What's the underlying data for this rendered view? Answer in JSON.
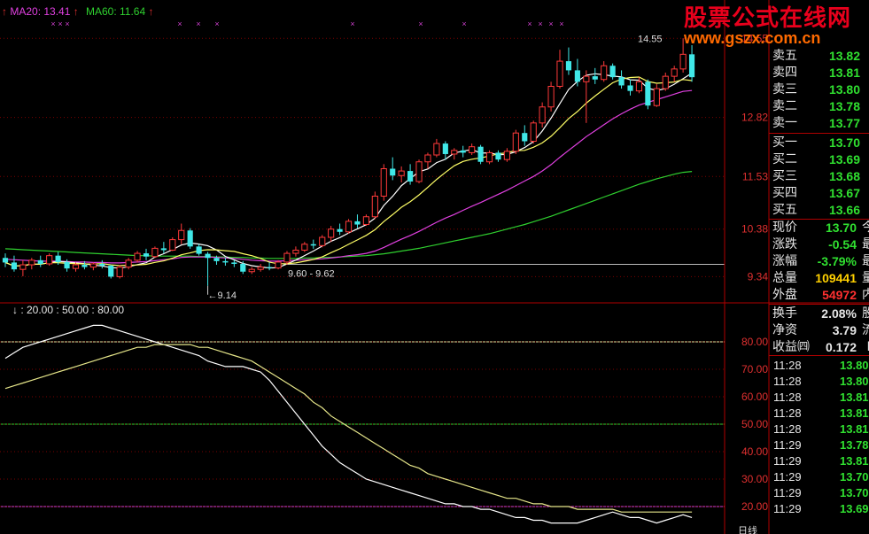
{
  "ma_labels": {
    "ma20": "MA20: 13.41",
    "ma60": "MA60: 11.64",
    "ma20_color": "#e040e0",
    "ma60_color": "#2fd02f"
  },
  "price_axis": {
    "ticks": [
      "14.55",
      "12.82",
      "11.53",
      "10.38",
      "9.34"
    ],
    "color": "#e03030"
  },
  "price_annotations": {
    "low_label": "9.14",
    "range_label": "9.60 - 9.62",
    "high_label": "14.55"
  },
  "indicator": {
    "label": "↓ : 20.00 : 50.00 : 80.00",
    "ticks": [
      "80.00",
      "70.00",
      "60.00",
      "50.00",
      "40.00",
      "30.00",
      "20.00"
    ]
  },
  "watermark": {
    "title": "股票公式在线网",
    "url": "www.gszx.com.cn"
  },
  "order_book": [
    {
      "label": "卖五",
      "value": "13.82",
      "color": "#30e030"
    },
    {
      "label": "卖四",
      "value": "13.81",
      "color": "#30e030"
    },
    {
      "label": "卖三",
      "value": "13.80",
      "color": "#30e030"
    },
    {
      "label": "卖二",
      "value": "13.78",
      "color": "#30e030"
    },
    {
      "label": "卖一",
      "value": "13.77",
      "color": "#30e030"
    },
    {
      "label": "买一",
      "value": "13.70",
      "color": "#30e030"
    },
    {
      "label": "买二",
      "value": "13.69",
      "color": "#30e030"
    },
    {
      "label": "买三",
      "value": "13.68",
      "color": "#30e030"
    },
    {
      "label": "买四",
      "value": "13.67",
      "color": "#30e030"
    },
    {
      "label": "买五",
      "value": "13.66",
      "color": "#30e030"
    }
  ],
  "quote_info": [
    {
      "label": "现价",
      "value": "13.70",
      "color": "#30e030",
      "extra": "今"
    },
    {
      "label": "涨跌",
      "value": "-0.54",
      "color": "#30e030",
      "extra": "最"
    },
    {
      "label": "涨幅",
      "value": "-3.79%",
      "color": "#30e030",
      "extra": "最"
    },
    {
      "label": "总量",
      "value": "109441",
      "color": "#ffd000",
      "extra": "量"
    },
    {
      "label": "外盘",
      "value": "54972",
      "color": "#ff3030",
      "extra": "内"
    }
  ],
  "stats": [
    {
      "label": "换手",
      "value": "2.08%",
      "color": "#e6e6e6",
      "extra": "股"
    },
    {
      "label": "净资",
      "value": "3.79",
      "color": "#e6e6e6",
      "extra": "流"
    },
    {
      "label": "收益㈣",
      "value": "0.172",
      "color": "#e6e6e6",
      "extra": "P"
    }
  ],
  "ticks": [
    {
      "time": "11:28",
      "price": "13.80",
      "color": "#30e030"
    },
    {
      "time": "11:28",
      "price": "13.80",
      "color": "#30e030"
    },
    {
      "time": "11:28",
      "price": "13.81",
      "color": "#30e030"
    },
    {
      "time": "11:28",
      "price": "13.81",
      "color": "#30e030"
    },
    {
      "time": "11:28",
      "price": "13.81",
      "color": "#30e030"
    },
    {
      "time": "11:29",
      "price": "13.78",
      "color": "#30e030"
    },
    {
      "time": "11:29",
      "price": "13.81",
      "color": "#30e030"
    },
    {
      "time": "11:29",
      "price": "13.70",
      "color": "#30e030"
    },
    {
      "time": "11:29",
      "price": "13.70",
      "color": "#30e030"
    },
    {
      "time": "11:29",
      "price": "13.69",
      "color": "#30e030"
    }
  ],
  "bottom_label": "日线",
  "chart_data": {
    "type": "candlestick",
    "candles": [
      [
        9.75,
        9.85,
        9.55,
        9.65
      ],
      [
        9.65,
        9.8,
        9.45,
        9.5
      ],
      [
        9.5,
        9.7,
        9.35,
        9.6
      ],
      [
        9.6,
        9.75,
        9.5,
        9.7
      ],
      [
        9.7,
        9.8,
        9.55,
        9.62
      ],
      [
        9.62,
        9.85,
        9.58,
        9.8
      ],
      [
        9.8,
        9.88,
        9.6,
        9.66
      ],
      [
        9.66,
        9.72,
        9.45,
        9.52
      ],
      [
        9.52,
        9.65,
        9.45,
        9.6
      ],
      [
        9.6,
        9.68,
        9.5,
        9.55
      ],
      [
        9.55,
        9.65,
        9.48,
        9.62
      ],
      [
        9.62,
        9.7,
        9.52,
        9.58
      ],
      [
        9.58,
        9.6,
        9.3,
        9.34
      ],
      [
        9.34,
        9.6,
        9.3,
        9.55
      ],
      [
        9.55,
        9.75,
        9.5,
        9.7
      ],
      [
        9.7,
        9.9,
        9.65,
        9.85
      ],
      [
        9.85,
        9.95,
        9.7,
        9.78
      ],
      [
        9.78,
        10.0,
        9.75,
        9.96
      ],
      [
        9.96,
        10.1,
        9.85,
        9.92
      ],
      [
        9.92,
        10.2,
        9.9,
        10.15
      ],
      [
        10.15,
        10.5,
        10.05,
        10.35
      ],
      [
        10.35,
        10.4,
        9.95,
        10.0
      ],
      [
        10.0,
        10.05,
        9.8,
        9.84
      ],
      [
        9.84,
        9.88,
        9.14,
        9.75
      ],
      [
        9.75,
        9.8,
        9.6,
        9.68
      ],
      [
        9.68,
        9.75,
        9.58,
        9.65
      ],
      [
        9.65,
        9.7,
        9.55,
        9.62
      ],
      [
        9.62,
        9.68,
        9.4,
        9.45
      ],
      [
        9.45,
        9.55,
        9.4,
        9.5
      ],
      [
        9.5,
        9.62,
        9.45,
        9.55
      ],
      [
        9.55,
        9.65,
        9.48,
        9.53
      ],
      [
        9.53,
        9.7,
        9.5,
        9.66
      ],
      [
        9.66,
        9.9,
        9.6,
        9.85
      ],
      [
        9.85,
        10.0,
        9.78,
        9.92
      ],
      [
        9.92,
        10.1,
        9.88,
        10.05
      ],
      [
        10.05,
        10.15,
        9.95,
        10.02
      ],
      [
        10.02,
        10.25,
        9.98,
        10.2
      ],
      [
        10.2,
        10.45,
        10.1,
        10.38
      ],
      [
        10.38,
        10.5,
        10.25,
        10.32
      ],
      [
        10.32,
        10.6,
        10.28,
        10.55
      ],
      [
        10.55,
        10.7,
        10.4,
        10.48
      ],
      [
        10.48,
        10.7,
        10.45,
        10.65
      ],
      [
        10.65,
        11.2,
        10.6,
        11.1
      ],
      [
        11.1,
        11.8,
        11.0,
        11.7
      ],
      [
        11.7,
        11.95,
        11.45,
        11.55
      ],
      [
        11.55,
        11.75,
        11.4,
        11.65
      ],
      [
        11.65,
        11.8,
        11.35,
        11.42
      ],
      [
        11.42,
        11.9,
        11.38,
        11.85
      ],
      [
        11.85,
        12.05,
        11.7,
        12.0
      ],
      [
        12.0,
        12.35,
        11.95,
        12.25
      ],
      [
        12.25,
        12.3,
        11.9,
        12.02
      ],
      [
        12.02,
        12.15,
        11.9,
        12.1
      ],
      [
        12.1,
        12.2,
        11.95,
        12.05
      ],
      [
        12.05,
        12.25,
        12.0,
        12.18
      ],
      [
        12.18,
        12.22,
        11.8,
        11.85
      ],
      [
        11.85,
        12.1,
        11.8,
        12.05
      ],
      [
        12.05,
        12.1,
        11.85,
        11.9
      ],
      [
        11.9,
        12.15,
        11.85,
        12.08
      ],
      [
        12.08,
        12.55,
        12.02,
        12.48
      ],
      [
        12.48,
        12.65,
        12.2,
        12.3
      ],
      [
        12.3,
        12.75,
        12.25,
        12.7
      ],
      [
        12.7,
        13.15,
        12.6,
        13.05
      ],
      [
        13.05,
        13.6,
        12.95,
        13.5
      ],
      [
        13.5,
        14.3,
        13.45,
        14.05
      ],
      [
        14.05,
        14.35,
        13.75,
        13.85
      ],
      [
        13.85,
        14.1,
        13.5,
        13.6
      ],
      [
        13.6,
        13.85,
        12.7,
        13.72
      ],
      [
        13.72,
        13.9,
        13.55,
        13.65
      ],
      [
        13.65,
        14.05,
        13.6,
        13.95
      ],
      [
        13.95,
        14.0,
        13.65,
        13.7
      ],
      [
        13.7,
        13.85,
        13.45,
        13.52
      ],
      [
        13.52,
        13.65,
        13.3,
        13.4
      ],
      [
        13.4,
        13.7,
        13.35,
        13.6
      ],
      [
        13.6,
        13.65,
        13.0,
        13.08
      ],
      [
        13.08,
        13.55,
        13.05,
        13.45
      ],
      [
        13.45,
        13.8,
        13.4,
        13.72
      ],
      [
        13.72,
        13.95,
        13.6,
        13.88
      ],
      [
        13.88,
        14.55,
        13.8,
        14.2
      ],
      [
        14.2,
        14.4,
        13.6,
        13.7
      ]
    ],
    "ma20": [
      9.72,
      9.71,
      9.7,
      9.69,
      9.68,
      9.68,
      9.68,
      9.67,
      9.66,
      9.66,
      9.65,
      9.65,
      9.64,
      9.64,
      9.65,
      9.66,
      9.67,
      9.69,
      9.71,
      9.73,
      9.76,
      9.77,
      9.77,
      9.77,
      9.76,
      9.75,
      9.74,
      9.72,
      9.7,
      9.69,
      9.68,
      9.68,
      9.69,
      9.7,
      9.71,
      9.72,
      9.73,
      9.75,
      9.77,
      9.8,
      9.82,
      9.85,
      9.9,
      9.98,
      10.07,
      10.16,
      10.24,
      10.33,
      10.43,
      10.53,
      10.62,
      10.7,
      10.79,
      10.88,
      10.96,
      11.05,
      11.14,
      11.23,
      11.33,
      11.43,
      11.53,
      11.65,
      11.79,
      11.95,
      12.1,
      12.25,
      12.4,
      12.53,
      12.66,
      12.79,
      12.9,
      13.0,
      13.09,
      13.15,
      13.21,
      13.27,
      13.33,
      13.39,
      13.41
    ],
    "ma60": [
      9.95,
      9.94,
      9.93,
      9.92,
      9.91,
      9.9,
      9.89,
      9.88,
      9.87,
      9.86,
      9.85,
      9.84,
      9.83,
      9.82,
      9.81,
      9.8,
      9.8,
      9.79,
      9.79,
      9.79,
      9.79,
      9.79,
      9.78,
      9.78,
      9.77,
      9.77,
      9.76,
      9.76,
      9.75,
      9.75,
      9.74,
      9.74,
      9.74,
      9.74,
      9.75,
      9.75,
      9.76,
      9.76,
      9.77,
      9.78,
      9.79,
      9.8,
      9.82,
      9.84,
      9.87,
      9.9,
      9.93,
      9.96,
      10.0,
      10.04,
      10.08,
      10.12,
      10.16,
      10.2,
      10.24,
      10.28,
      10.33,
      10.38,
      10.43,
      10.48,
      10.54,
      10.6,
      10.66,
      10.73,
      10.8,
      10.87,
      10.94,
      11.01,
      11.08,
      11.15,
      11.22,
      11.29,
      11.36,
      11.42,
      11.48,
      11.53,
      11.58,
      11.62,
      11.64
    ],
    "ylim": [
      9.0,
      15.0
    ],
    "indicator_series": [
      {
        "values": [
          74,
          76,
          78,
          79,
          80,
          81,
          82,
          83,
          84,
          85,
          86,
          86,
          85,
          84,
          83,
          82,
          81,
          80,
          79,
          78,
          77,
          76,
          75,
          73,
          72,
          71,
          71,
          71,
          70,
          69,
          66,
          62,
          58,
          54,
          50,
          46,
          42,
          39,
          36,
          34,
          32,
          30,
          29,
          28,
          27,
          26,
          25,
          24,
          23,
          22,
          21,
          21,
          20,
          20,
          19,
          19,
          18,
          17,
          16,
          16,
          15,
          15,
          14,
          14,
          14,
          14,
          15,
          16,
          17,
          18,
          17,
          16,
          16,
          15,
          14,
          15,
          16,
          17,
          16
        ]
      },
      {
        "values": [
          63,
          64,
          65,
          66,
          67,
          68,
          69,
          70,
          71,
          72,
          73,
          74,
          75,
          76,
          77,
          78,
          78,
          79,
          79,
          79,
          79,
          79,
          78,
          78,
          77,
          76,
          75,
          74,
          73,
          71,
          69,
          67,
          65,
          63,
          61,
          58,
          56,
          53,
          51,
          49,
          47,
          45,
          43,
          41,
          39,
          37,
          35,
          34,
          32,
          31,
          30,
          29,
          28,
          27,
          26,
          25,
          24,
          23,
          23,
          22,
          21,
          21,
          20,
          20,
          20,
          19,
          19,
          19,
          19,
          19,
          18,
          18,
          18,
          18,
          18,
          18,
          18,
          18,
          18
        ]
      }
    ],
    "indicator_levels": [
      80,
      50,
      20
    ],
    "indicator_ylim": [
      10,
      90
    ]
  }
}
